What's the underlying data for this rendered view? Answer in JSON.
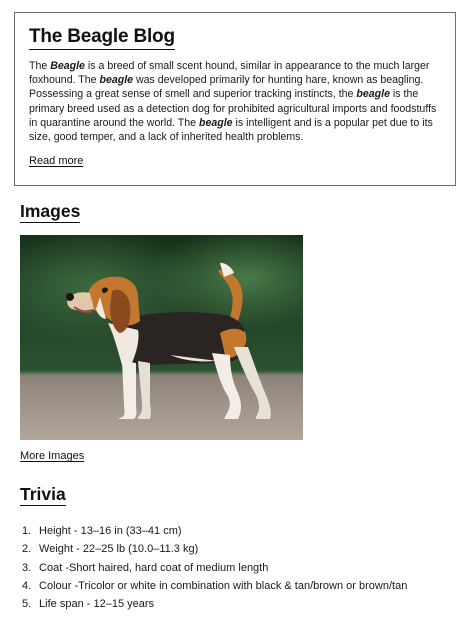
{
  "blog": {
    "title": "The Beagle Blog",
    "paragraph": [
      {
        "t": "The "
      },
      {
        "t": "Beagle",
        "b": true
      },
      {
        "t": " is a breed of small scent hound, similar in appearance to the much larger foxhound. The "
      },
      {
        "t": "beagle",
        "b": true
      },
      {
        "t": " was developed primarily for hunting hare, known as beagling. Possessing a great sense of smell and superior tracking instincts, the "
      },
      {
        "t": "beagle",
        "b": true
      },
      {
        "t": " is the primary breed used as a detection dog for prohibited agricultural imports and foodstuffs in quarantine around the world. The "
      },
      {
        "t": "beagle",
        "b": true
      },
      {
        "t": " is intelligent and is a popular pet due to its size, good temper, and a lack of inherited health problems."
      }
    ],
    "read_more": "Read more"
  },
  "images": {
    "heading": "Images",
    "photo_alt": "beagle-photo",
    "more_link": "More Images"
  },
  "trivia": {
    "heading": "Trivia",
    "items": [
      "Height - 13–16 in (33–41 cm)",
      "Weight - 22–25 lb (10.0–11.3 kg)",
      "Coat -Short haired, hard coat of medium length",
      "Colour -Tricolor or white in combination with black & tan/brown or brown/tan",
      "Life span - 12–15 years"
    ]
  },
  "colors": {
    "text": "#111111",
    "card_border": "#6e6e6e",
    "photo_background": "#1f3a1c",
    "ground": "#a89e94"
  }
}
